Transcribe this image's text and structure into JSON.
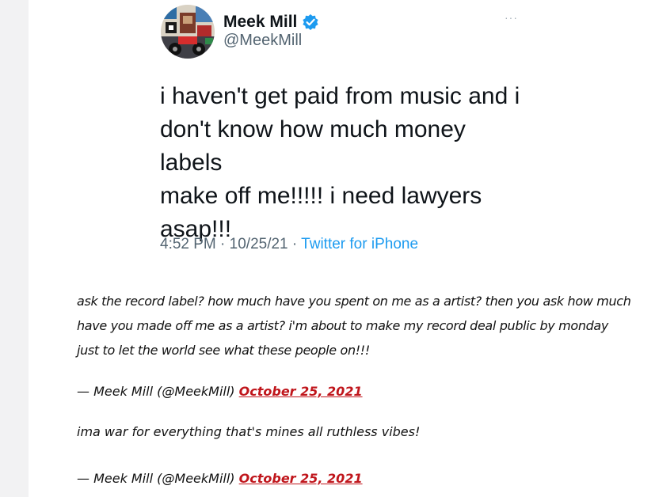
{
  "tweet": {
    "display_name": "Meek Mill",
    "handle": "@MeekMill",
    "verified_icon": "verified-badge-icon",
    "more_icon": "···",
    "text": "i haven't get paid from music and i\ndon't know how much money labels\nmake off me!!!!!  i need lawyers\nasap!!!",
    "time": "4:52 PM",
    "date": "10/25/21",
    "separator": "·",
    "source": "Twitter for iPhone"
  },
  "embeds": [
    {
      "text": "ask the record label? how much have you spent on me as a artist? then you ask how much have you made off me as a artist? i'm about to make my record deal public by monday just to let the world see what these people on!!!",
      "attribution": "— Meek Mill (@MeekMill)",
      "link": "October 25, 2021"
    },
    {
      "text": "ima war for everything that's mines all ruthless vibes!",
      "attribution": "— Meek Mill (@MeekMill)",
      "link": "October 25, 2021"
    }
  ],
  "colors": {
    "link_red": "#c0161c",
    "twitter_blue": "#1d9bf0",
    "muted_gray": "#536471"
  }
}
